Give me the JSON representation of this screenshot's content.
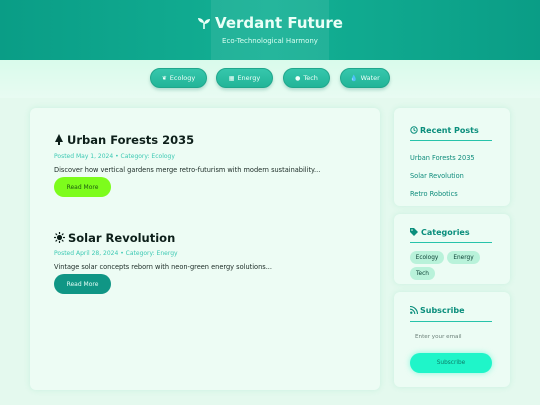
{
  "site": {
    "title": "Verdant Future",
    "tagline": "Eco-Technological Harmony"
  },
  "nav": [
    {
      "label": "Ecology",
      "icon": "leaf-icon"
    },
    {
      "label": "Energy",
      "icon": "solar-panel-icon"
    },
    {
      "label": "Tech",
      "icon": "robot-icon"
    },
    {
      "label": "Water",
      "icon": "droplet-icon"
    }
  ],
  "posts": [
    {
      "icon": "tree-icon",
      "title": "Urban Forests 2035",
      "meta": "Posted May 1, 2024 • Category: Ecology",
      "excerpt": "Discover how vertical gardens merge retro-futurism with modern sustainability...",
      "button": "Read More"
    },
    {
      "icon": "sun-icon",
      "title": "Solar Revolution",
      "meta": "Posted April 28, 2024 • Category: Energy",
      "excerpt": "Vintage solar concepts reborn with neon-green energy solutions...",
      "button": "Read More"
    }
  ],
  "sidebar": {
    "recent": {
      "heading": "Recent Posts",
      "links": [
        "Urban Forests 2035",
        "Solar Revolution",
        "Retro Robotics"
      ]
    },
    "categories": {
      "heading": "Categories",
      "tags": [
        "Ecology",
        "Energy",
        "Tech"
      ]
    },
    "subscribe": {
      "heading": "Subscribe",
      "placeholder": "Enter your email",
      "button": "Subscribe"
    }
  },
  "colors": {
    "header": "#0fa88d",
    "accent_lime": "#7dfc1c",
    "accent_teal": "#109685",
    "accent_mint": "#1ff5c9"
  }
}
